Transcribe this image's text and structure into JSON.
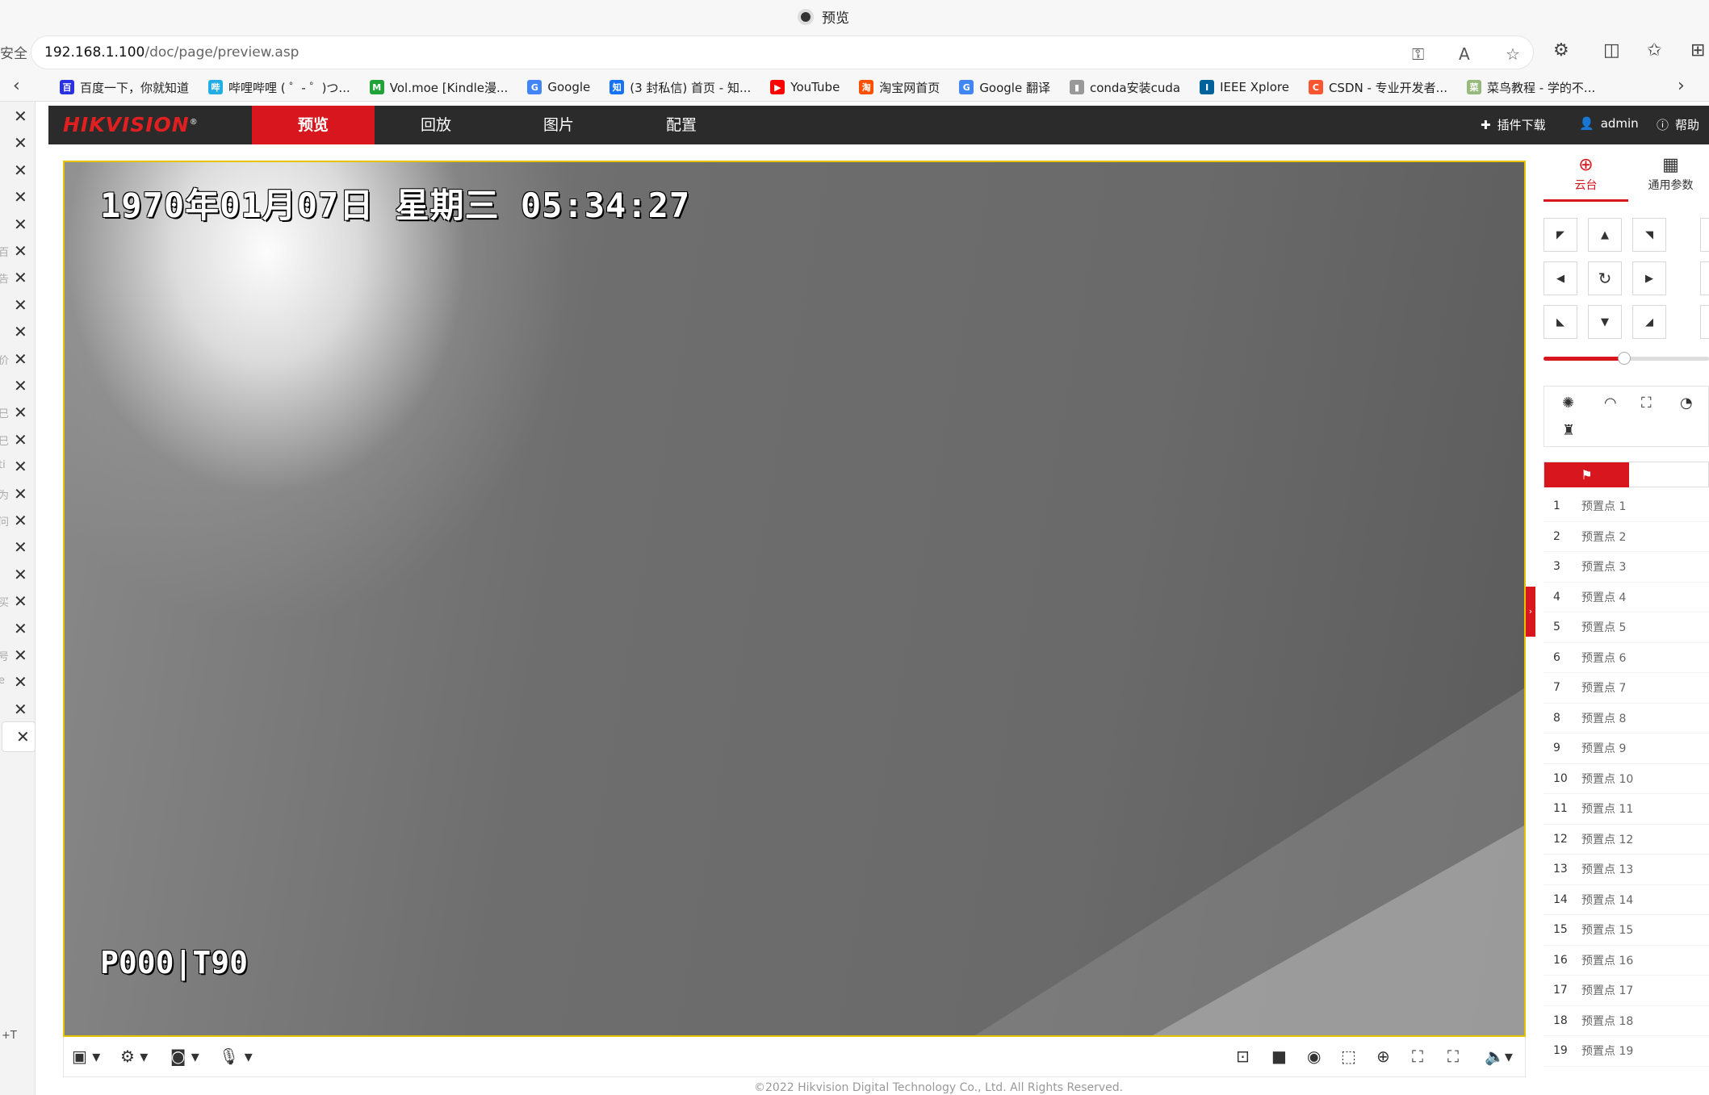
{
  "browser": {
    "window_title": "预览",
    "security_label": "安全",
    "url_host": "192.168.1.100",
    "url_path": "/doc/page/preview.asp",
    "bookmarks": [
      {
        "label": "百度一下，你就知道",
        "icon": "baidu-icon",
        "color": "#2932e1",
        "glyph": "百"
      },
      {
        "label": "哔哩哔哩 ( ゜- ゜)つ...",
        "icon": "bilibili-icon",
        "color": "#23ade5",
        "glyph": "哔"
      },
      {
        "label": "Vol.moe [Kindle漫...",
        "icon": "volmoe-icon",
        "color": "#22a33a",
        "glyph": "M"
      },
      {
        "label": "Google",
        "icon": "google-icon",
        "color": "#4285f4",
        "glyph": "G"
      },
      {
        "label": "(3 封私信) 首页 - 知...",
        "icon": "zhihu-icon",
        "color": "#1772f6",
        "glyph": "知"
      },
      {
        "label": "YouTube",
        "icon": "youtube-icon",
        "color": "#ff0000",
        "glyph": "▶"
      },
      {
        "label": "淘宝网首页",
        "icon": "taobao-icon",
        "color": "#ff5000",
        "glyph": "淘"
      },
      {
        "label": "Google 翻译",
        "icon": "google-translate-icon",
        "color": "#4285f4",
        "glyph": "G"
      },
      {
        "label": "conda安装cuda",
        "icon": "folder-icon",
        "color": "#999999",
        "glyph": "▮"
      },
      {
        "label": "IEEE Xplore",
        "icon": "ieee-icon",
        "color": "#00629b",
        "glyph": "I"
      },
      {
        "label": "CSDN - 专业开发者...",
        "icon": "csdn-icon",
        "color": "#fc5531",
        "glyph": "C"
      },
      {
        "label": "菜鸟教程 - 学的不...",
        "icon": "runoob-icon",
        "color": "#96b97d",
        "glyph": "菜"
      }
    ]
  },
  "left_tabs": {
    "side_chars": [
      "",
      "",
      "",
      "",
      "",
      "百",
      "告",
      "",
      "",
      "价",
      "",
      "巳",
      "巳",
      "ti",
      "为",
      "问",
      "",
      "",
      "买",
      "",
      "号",
      "e",
      "",
      ""
    ],
    "bottom_label": "+T"
  },
  "hik": {
    "logo": "HIKVISION",
    "logo_mark": "®",
    "tabs": [
      "预览",
      "回放",
      "图片",
      "配置"
    ],
    "active_tab": 0,
    "plugin_label": "插件下载",
    "user_label": "admin",
    "help_label": "帮助",
    "osd_datetime": "1970年01月07日  星期三 05:34:27",
    "osd_ptz": "P000|T90",
    "copyright": "©2022 Hikvision Digital Technology Co., Ltd. All Rights Reserved.",
    "accent": "#d7161d"
  },
  "ptz": {
    "tab_ptz": "云台",
    "tab_params": "通用参数",
    "speed_fraction": 0.49,
    "presets": [
      {
        "num": "1",
        "name": "预置点 1"
      },
      {
        "num": "2",
        "name": "预置点 2"
      },
      {
        "num": "3",
        "name": "预置点 3"
      },
      {
        "num": "4",
        "name": "预置点 4"
      },
      {
        "num": "5",
        "name": "预置点 5"
      },
      {
        "num": "6",
        "name": "预置点 6"
      },
      {
        "num": "7",
        "name": "预置点 7"
      },
      {
        "num": "8",
        "name": "预置点 8"
      },
      {
        "num": "9",
        "name": "预置点 9"
      },
      {
        "num": "10",
        "name": "预置点 10"
      },
      {
        "num": "11",
        "name": "预置点 11"
      },
      {
        "num": "12",
        "name": "预置点 12"
      },
      {
        "num": "13",
        "name": "预置点 13"
      },
      {
        "num": "14",
        "name": "预置点 14"
      },
      {
        "num": "15",
        "name": "预置点 15"
      },
      {
        "num": "16",
        "name": "预置点 16"
      },
      {
        "num": "17",
        "name": "预置点 17"
      },
      {
        "num": "18",
        "name": "预置点 18"
      },
      {
        "num": "19",
        "name": "预置点 19"
      }
    ]
  }
}
